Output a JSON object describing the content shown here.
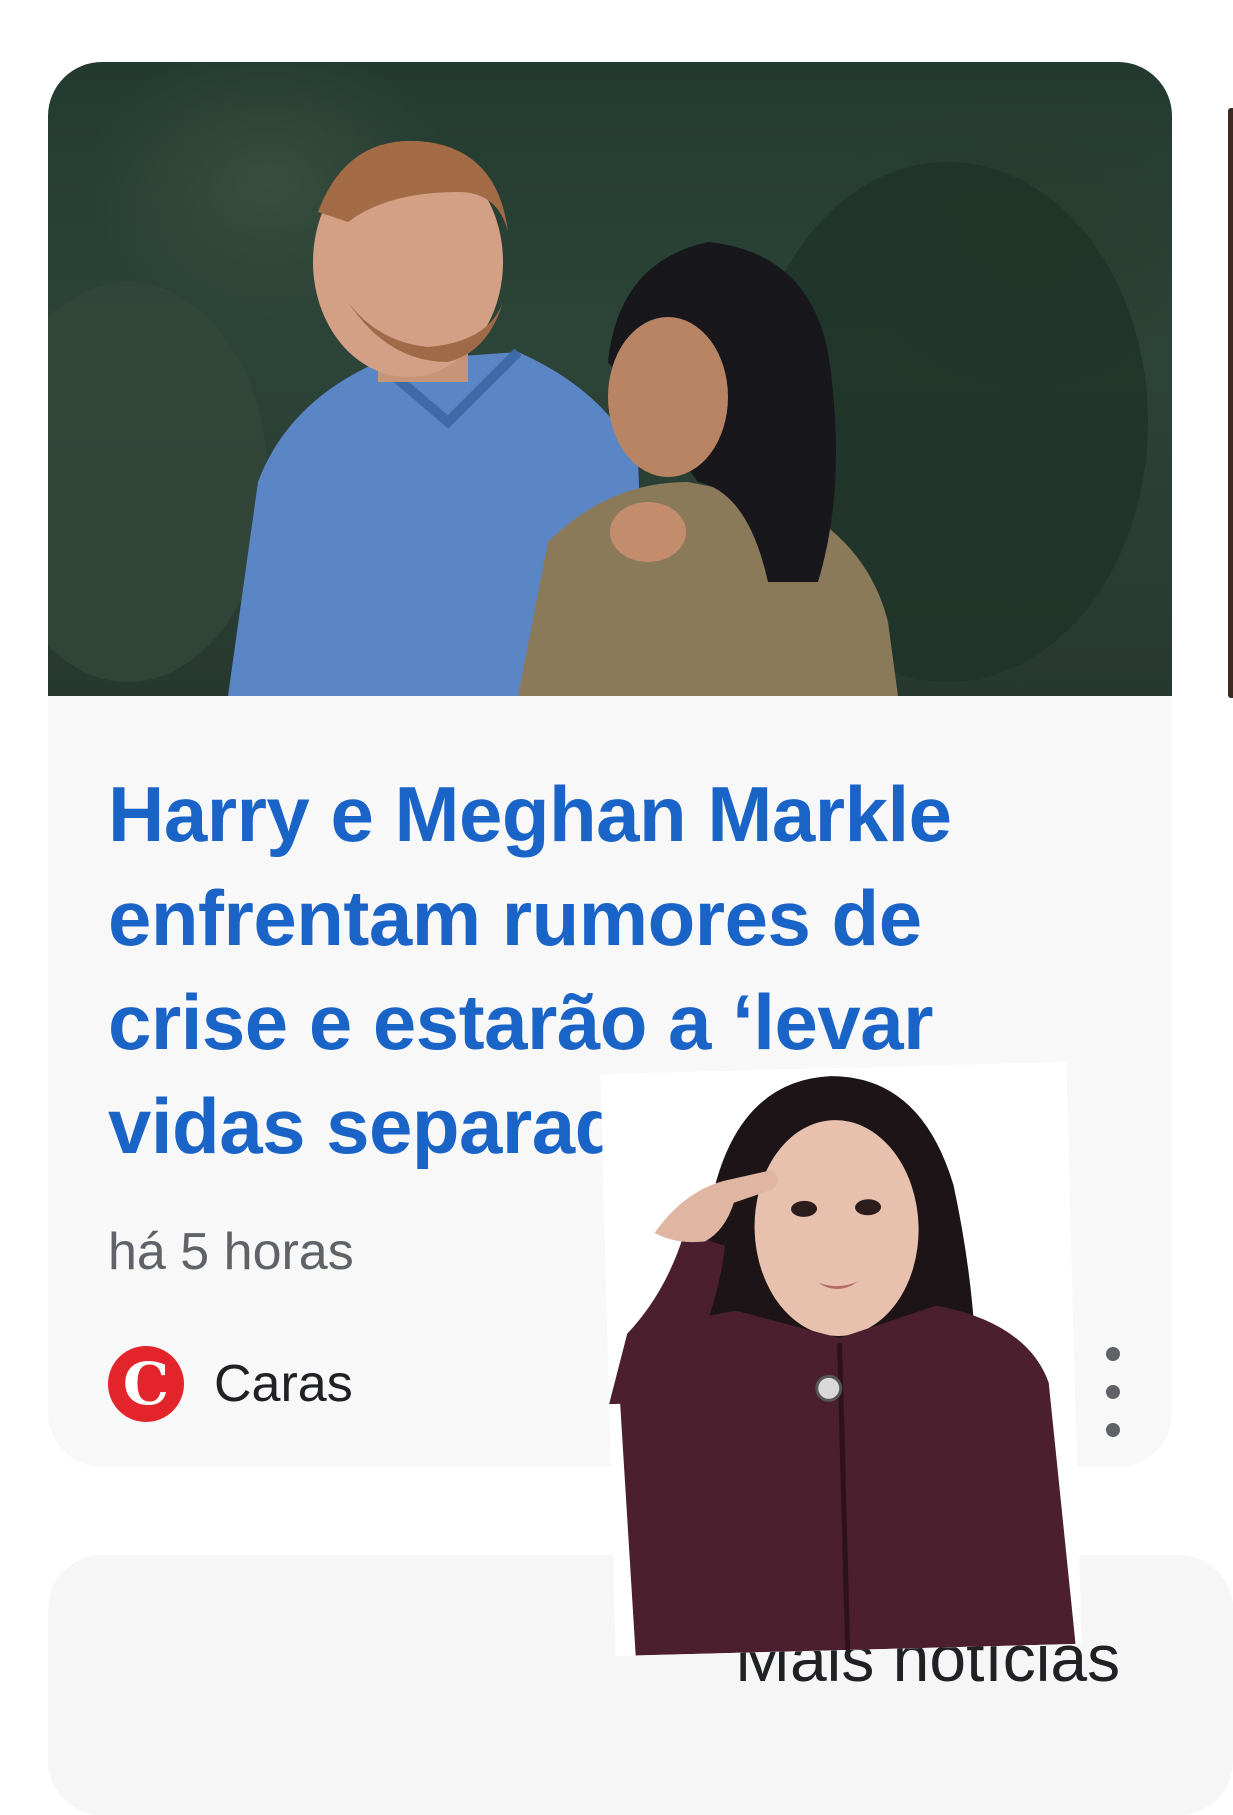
{
  "article": {
    "image_alt": "Harry e Meghan Markle",
    "headline": "Harry e Meghan Markle enfrentam rumores de crise e estarão a ‘levar vidas separadas’",
    "time": "há 5 horas",
    "source": {
      "logo_letter": "C",
      "name": "Caras",
      "logo_color": "#e3242b"
    },
    "headline_color": "#1a64c8",
    "menu_icon": "more-vert-icon"
  },
  "section": {
    "more_news_label": "Mais notícias"
  },
  "overlay": {
    "icon": "person-thinking"
  }
}
